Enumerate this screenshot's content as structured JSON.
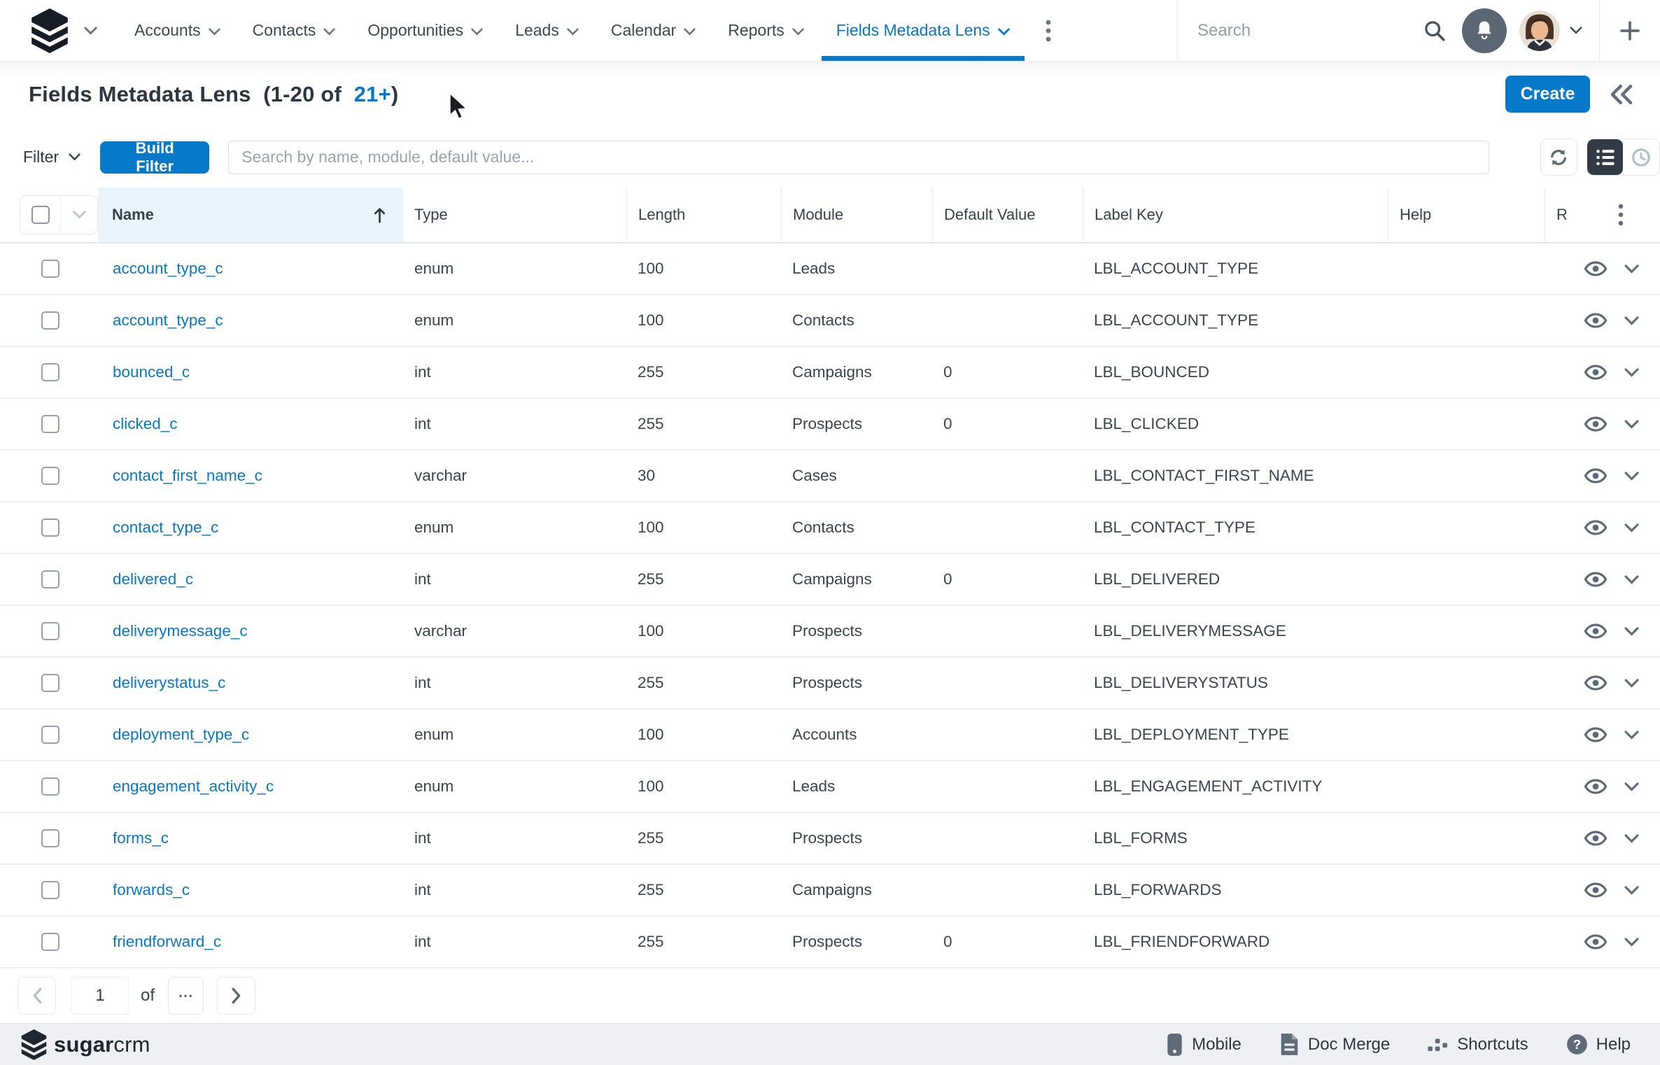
{
  "nav": {
    "items": [
      {
        "label": "Accounts"
      },
      {
        "label": "Contacts"
      },
      {
        "label": "Opportunities"
      },
      {
        "label": "Leads"
      },
      {
        "label": "Calendar"
      },
      {
        "label": "Reports"
      }
    ],
    "active_item": "Fields Metadata Lens",
    "search_placeholder": "Search"
  },
  "header": {
    "title": "Fields Metadata Lens",
    "range_text": "(1-20 of",
    "total_link": "21+",
    "range_suffix": ")",
    "create_label": "Create"
  },
  "filter_bar": {
    "filter_label": "Filter",
    "build_filter_label": "Build Filter",
    "search_placeholder": "Search by name, module, default value..."
  },
  "table": {
    "columns": [
      "Name",
      "Type",
      "Length",
      "Module",
      "Default Value",
      "Label Key",
      "Help",
      "R"
    ],
    "rows": [
      {
        "name": "account_type_c",
        "type": "enum",
        "length": "100",
        "module": "Leads",
        "default_value": "",
        "label_key": "LBL_ACCOUNT_TYPE",
        "help": ""
      },
      {
        "name": "account_type_c",
        "type": "enum",
        "length": "100",
        "module": "Contacts",
        "default_value": "",
        "label_key": "LBL_ACCOUNT_TYPE",
        "help": ""
      },
      {
        "name": "bounced_c",
        "type": "int",
        "length": "255",
        "module": "Campaigns",
        "default_value": "0",
        "label_key": "LBL_BOUNCED",
        "help": ""
      },
      {
        "name": "clicked_c",
        "type": "int",
        "length": "255",
        "module": "Prospects",
        "default_value": "0",
        "label_key": "LBL_CLICKED",
        "help": ""
      },
      {
        "name": "contact_first_name_c",
        "type": "varchar",
        "length": "30",
        "module": "Cases",
        "default_value": "",
        "label_key": "LBL_CONTACT_FIRST_NAME",
        "help": ""
      },
      {
        "name": "contact_type_c",
        "type": "enum",
        "length": "100",
        "module": "Contacts",
        "default_value": "",
        "label_key": "LBL_CONTACT_TYPE",
        "help": ""
      },
      {
        "name": "delivered_c",
        "type": "int",
        "length": "255",
        "module": "Campaigns",
        "default_value": "0",
        "label_key": "LBL_DELIVERED",
        "help": ""
      },
      {
        "name": "deliverymessage_c",
        "type": "varchar",
        "length": "100",
        "module": "Prospects",
        "default_value": "",
        "label_key": "LBL_DELIVERYMESSAGE",
        "help": ""
      },
      {
        "name": "deliverystatus_c",
        "type": "int",
        "length": "255",
        "module": "Prospects",
        "default_value": "",
        "label_key": "LBL_DELIVERYSTATUS",
        "help": ""
      },
      {
        "name": "deployment_type_c",
        "type": "enum",
        "length": "100",
        "module": "Accounts",
        "default_value": "",
        "label_key": "LBL_DEPLOYMENT_TYPE",
        "help": ""
      },
      {
        "name": "engagement_activity_c",
        "type": "enum",
        "length": "100",
        "module": "Leads",
        "default_value": "",
        "label_key": "LBL_ENGAGEMENT_ACTIVITY",
        "help": ""
      },
      {
        "name": "forms_c",
        "type": "int",
        "length": "255",
        "module": "Prospects",
        "default_value": "",
        "label_key": "LBL_FORMS",
        "help": ""
      },
      {
        "name": "forwards_c",
        "type": "int",
        "length": "255",
        "module": "Campaigns",
        "default_value": "",
        "label_key": "LBL_FORWARDS",
        "help": ""
      },
      {
        "name": "friendforward_c",
        "type": "int",
        "length": "255",
        "module": "Prospects",
        "default_value": "0",
        "label_key": "LBL_FRIENDFORWARD",
        "help": ""
      }
    ]
  },
  "pagination": {
    "page": "1",
    "of_label": "of",
    "more_label": "..."
  },
  "footer": {
    "brand_bold": "sugar",
    "brand_light": "crm",
    "links": [
      "Mobile",
      "Doc Merge",
      "Shortcuts",
      "Help"
    ]
  },
  "colors": {
    "accent": "#0679c8",
    "icon_gray": "#5f6b76",
    "name_column_bg": "#e9f5fd"
  }
}
